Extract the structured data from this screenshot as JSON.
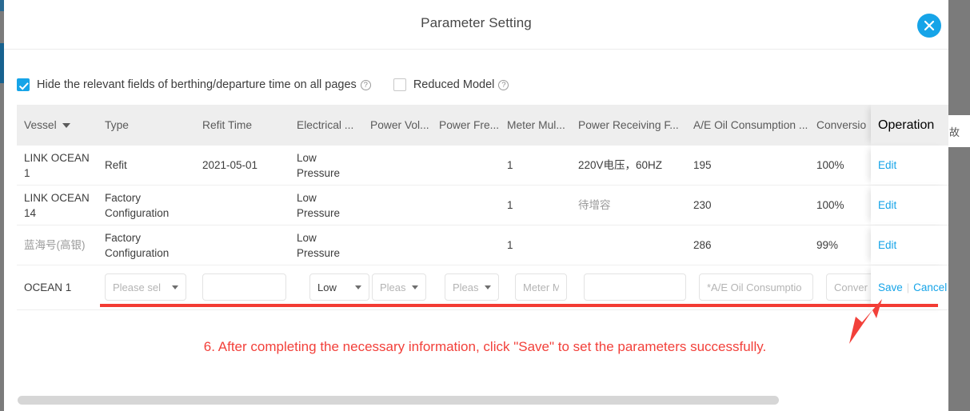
{
  "modal": {
    "title": "Parameter Setting",
    "close_icon": "close-icon"
  },
  "options": [
    {
      "label": "Hide the relevant fields of berthing/departure time on all pages",
      "checked": true,
      "help": "?"
    },
    {
      "label": "Reduced Model",
      "checked": false,
      "help": "?"
    }
  ],
  "table": {
    "columns": [
      "Vessel",
      "Type",
      "Refit Time",
      "Electrical ...",
      "Power Vol...",
      "Power Fre...",
      "Meter Mul...",
      "Power Receiving F...",
      "A/E Oil Consumption ...",
      "Conversio",
      "Operation"
    ],
    "rows": [
      {
        "vessel": "LINK OCEAN 1",
        "type": "Refit",
        "refit_time": "2021-05-01",
        "electrical": "Low Pressure",
        "power_voltage": "",
        "power_frequency": "",
        "meter_multiple": "1",
        "power_receiving": "220V电压，60HZ",
        "ae_oil_consumption": "195",
        "conversion": "100%",
        "operation": "Edit"
      },
      {
        "vessel": "LINK OCEAN 14",
        "type": "Factory Configuration",
        "refit_time": "",
        "electrical": "Low Pressure",
        "power_voltage": "",
        "power_frequency": "",
        "meter_multiple": "1",
        "power_receiving": "待增容",
        "ae_oil_consumption": "230",
        "conversion": "100%",
        "operation": "Edit"
      },
      {
        "vessel": "蓝海号(高银)",
        "type": "Factory Configuration",
        "refit_time": "",
        "electrical": "Low Pressure",
        "power_voltage": "",
        "power_frequency": "",
        "meter_multiple": "1",
        "power_receiving": "",
        "ae_oil_consumption": "286",
        "conversion": "99%",
        "operation": "Edit"
      }
    ],
    "edit_row": {
      "vessel": "OCEAN 1",
      "type_value": "Please sel",
      "refit_time_value": "",
      "electrical_value": "Low",
      "power_voltage_value": "Pleas",
      "power_frequency_value": "Pleas",
      "meter_multiple_placeholder": "Meter M",
      "power_receiving_value": "",
      "ae_oil_placeholder": "*A/E Oil Consumptio",
      "conversion_placeholder": "Conver",
      "save_label": "Save",
      "separator": "|",
      "cancel_label": "Cancel"
    }
  },
  "annotation": {
    "text": "6. After completing the necessary information, click \"Save\" to set the parameters successfully.",
    "color": "#f2403a"
  },
  "background": {
    "right_char": "故"
  },
  "colors": {
    "accent": "#16a4e8",
    "header_bg": "#eeeeee",
    "annotation_red": "#f2403a"
  }
}
